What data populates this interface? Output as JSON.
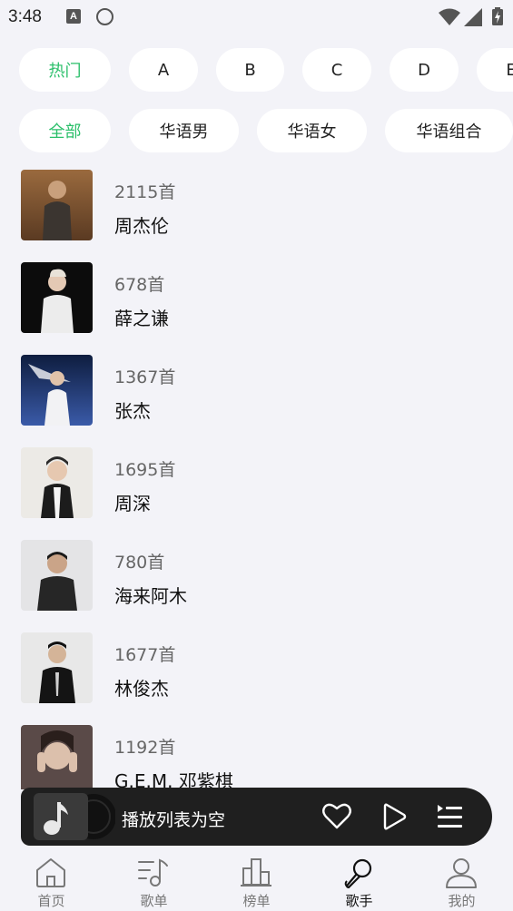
{
  "status_bar": {
    "time": "3:48",
    "notif_icon_letter": "A",
    "icons": [
      "text-notification-icon",
      "circle-notification-icon",
      "wifi-icon",
      "signal-icon",
      "battery-charging-icon"
    ]
  },
  "letter_filters": [
    {
      "label": "热门",
      "active": true
    },
    {
      "label": "A",
      "active": false
    },
    {
      "label": "B",
      "active": false
    },
    {
      "label": "C",
      "active": false
    },
    {
      "label": "D",
      "active": false
    },
    {
      "label": "E",
      "active": false
    }
  ],
  "category_filters": [
    {
      "label": "全部",
      "active": true
    },
    {
      "label": "华语男",
      "active": false
    },
    {
      "label": "华语女",
      "active": false
    },
    {
      "label": "华语组合",
      "active": false
    }
  ],
  "singers": [
    {
      "count": "2115首",
      "name": "周杰伦"
    },
    {
      "count": "678首",
      "name": "薛之谦"
    },
    {
      "count": "1367首",
      "name": "张杰"
    },
    {
      "count": "1695首",
      "name": "周深"
    },
    {
      "count": "780首",
      "name": "海来阿木"
    },
    {
      "count": "1677首",
      "name": "林俊杰"
    },
    {
      "count": "1192首",
      "name": "G.E.M. 邓紫棋"
    }
  ],
  "player": {
    "text": "播放列表为空",
    "icons": [
      "music-note-icon",
      "heart-icon",
      "play-icon",
      "playlist-icon"
    ]
  },
  "bottom_nav": [
    {
      "label": "首页",
      "icon": "home-icon",
      "active": false
    },
    {
      "label": "歌单",
      "icon": "playlist-note-icon",
      "active": false
    },
    {
      "label": "榜单",
      "icon": "bar-chart-icon",
      "active": false
    },
    {
      "label": "歌手",
      "icon": "microphone-icon",
      "active": true
    },
    {
      "label": "我的",
      "icon": "person-icon",
      "active": false
    }
  ],
  "colors": {
    "accent": "#2bbf6a",
    "background": "#f3f3f8",
    "player_bg": "#1f1f1f"
  }
}
